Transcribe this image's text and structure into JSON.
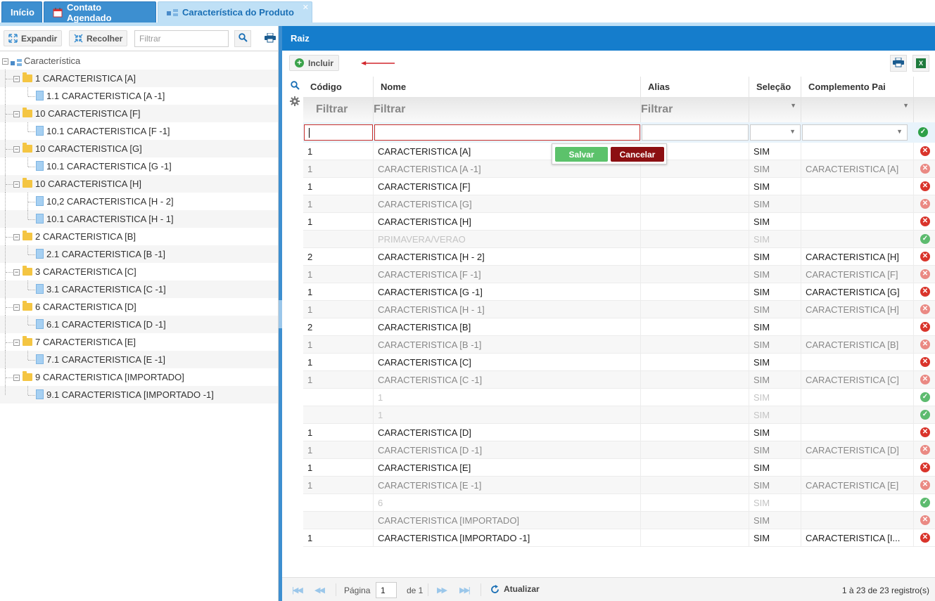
{
  "tabs": [
    {
      "label": "Início"
    },
    {
      "label": "Contato Agendado"
    },
    {
      "label": "Característica do Produto"
    }
  ],
  "left_panel": {
    "expand_label": "Expandir",
    "collapse_label": "Recolher",
    "filter_placeholder": "Filtrar",
    "tree_root": "Característica",
    "tree": [
      {
        "label": "1 CARACTERISTICA [A]",
        "level": 1,
        "type": "folder"
      },
      {
        "label": "1.1 CARACTERISTICA [A -1]",
        "level": 2,
        "type": "file"
      },
      {
        "label": "10 CARACTERISTICA [F]",
        "level": 1,
        "type": "folder"
      },
      {
        "label": "10.1 CARACTERISTICA [F -1]",
        "level": 2,
        "type": "file"
      },
      {
        "label": "10 CARACTERISTICA [G]",
        "level": 1,
        "type": "folder"
      },
      {
        "label": "10.1 CARACTERISTICA [G -1]",
        "level": 2,
        "type": "file"
      },
      {
        "label": "10 CARACTERISTICA [H]",
        "level": 1,
        "type": "folder"
      },
      {
        "label": "10,2 CARACTERISTICA [H - 2]",
        "level": 2,
        "type": "file"
      },
      {
        "label": "10.1 CARACTERISTICA [H - 1]",
        "level": 2,
        "type": "file"
      },
      {
        "label": "2 CARACTERISTICA [B]",
        "level": 1,
        "type": "folder"
      },
      {
        "label": "2.1 CARACTERISTICA [B -1]",
        "level": 2,
        "type": "file"
      },
      {
        "label": "3 CARACTERISTICA [C]",
        "level": 1,
        "type": "folder"
      },
      {
        "label": "3.1 CARACTERISTICA [C -1]",
        "level": 2,
        "type": "file"
      },
      {
        "label": "6 CARACTERISTICA [D]",
        "level": 1,
        "type": "folder"
      },
      {
        "label": "6.1 CARACTERISTICA [D -1]",
        "level": 2,
        "type": "file"
      },
      {
        "label": "7 CARACTERISTICA [E]",
        "level": 1,
        "type": "folder"
      },
      {
        "label": "7.1 CARACTERISTICA [E -1]",
        "level": 2,
        "type": "file"
      },
      {
        "label": "9 CARACTERISTICA [IMPORTADO]",
        "level": 1,
        "type": "folder"
      },
      {
        "label": "9.1 CARACTERISTICA [IMPORTADO -1]",
        "level": 2,
        "type": "file"
      }
    ]
  },
  "right_panel": {
    "title": "Raiz",
    "add_label": "Incluir",
    "columns": [
      "Código",
      "Nome",
      "Alias",
      "Seleção",
      "Complemento Pai"
    ],
    "filter_label": "Filtrar",
    "save_label": "Salvar",
    "cancel_label": "Cancelar",
    "rows": [
      {
        "codigo": "1",
        "nome": "CARACTERISTICA [A]",
        "alias": "",
        "selecao": "SIM",
        "complemento": "",
        "style": "normal",
        "action": "delete"
      },
      {
        "codigo": "1",
        "nome": "CARACTERISTICA [A -1]",
        "alias": "",
        "selecao": "SIM",
        "complemento": "CARACTERISTICA [A]",
        "style": "dim",
        "action": "delete"
      },
      {
        "codigo": "1",
        "nome": "CARACTERISTICA [F]",
        "alias": "",
        "selecao": "SIM",
        "complemento": "",
        "style": "normal",
        "action": "delete"
      },
      {
        "codigo": "1",
        "nome": "CARACTERISTICA [G]",
        "alias": "",
        "selecao": "SIM",
        "complemento": "",
        "style": "dim",
        "action": "delete"
      },
      {
        "codigo": "1",
        "nome": "CARACTERISTICA [H]",
        "alias": "",
        "selecao": "SIM",
        "complemento": "",
        "style": "normal",
        "action": "delete"
      },
      {
        "codigo": "",
        "nome": "PRIMAVERA/VERAO",
        "alias": "",
        "selecao": "SIM",
        "complemento": "",
        "style": "ghost",
        "action": "activate"
      },
      {
        "codigo": "2",
        "nome": "CARACTERISTICA [H - 2]",
        "alias": "",
        "selecao": "SIM",
        "complemento": "CARACTERISTICA [H]",
        "style": "normal",
        "action": "delete"
      },
      {
        "codigo": "1",
        "nome": "CARACTERISTICA [F -1]",
        "alias": "",
        "selecao": "SIM",
        "complemento": "CARACTERISTICA [F]",
        "style": "dim",
        "action": "delete"
      },
      {
        "codigo": "1",
        "nome": "CARACTERISTICA [G -1]",
        "alias": "",
        "selecao": "SIM",
        "complemento": "CARACTERISTICA [G]",
        "style": "normal",
        "action": "delete"
      },
      {
        "codigo": "1",
        "nome": "CARACTERISTICA [H - 1]",
        "alias": "",
        "selecao": "SIM",
        "complemento": "CARACTERISTICA [H]",
        "style": "dim",
        "action": "delete"
      },
      {
        "codigo": "2",
        "nome": "CARACTERISTICA [B]",
        "alias": "",
        "selecao": "SIM",
        "complemento": "",
        "style": "normal",
        "action": "delete"
      },
      {
        "codigo": "1",
        "nome": "CARACTERISTICA [B -1]",
        "alias": "",
        "selecao": "SIM",
        "complemento": "CARACTERISTICA [B]",
        "style": "dim",
        "action": "delete"
      },
      {
        "codigo": "1",
        "nome": "CARACTERISTICA [C]",
        "alias": "",
        "selecao": "SIM",
        "complemento": "",
        "style": "normal",
        "action": "delete"
      },
      {
        "codigo": "1",
        "nome": "CARACTERISTICA [C -1]",
        "alias": "",
        "selecao": "SIM",
        "complemento": "CARACTERISTICA [C]",
        "style": "dim",
        "action": "delete"
      },
      {
        "codigo": "",
        "nome": "1",
        "alias": "",
        "selecao": "SIM",
        "complemento": "",
        "style": "ghost",
        "action": "activate"
      },
      {
        "codigo": "",
        "nome": "1",
        "alias": "",
        "selecao": "SIM",
        "complemento": "",
        "style": "ghost",
        "action": "activate"
      },
      {
        "codigo": "1",
        "nome": "CARACTERISTICA [D]",
        "alias": "",
        "selecao": "SIM",
        "complemento": "",
        "style": "normal",
        "action": "delete"
      },
      {
        "codigo": "1",
        "nome": "CARACTERISTICA [D -1]",
        "alias": "",
        "selecao": "SIM",
        "complemento": "CARACTERISTICA [D]",
        "style": "dim",
        "action": "delete"
      },
      {
        "codigo": "1",
        "nome": "CARACTERISTICA [E]",
        "alias": "",
        "selecao": "SIM",
        "complemento": "",
        "style": "normal",
        "action": "delete"
      },
      {
        "codigo": "1",
        "nome": "CARACTERISTICA [E -1]",
        "alias": "",
        "selecao": "SIM",
        "complemento": "CARACTERISTICA [E]",
        "style": "dim",
        "action": "delete"
      },
      {
        "codigo": "",
        "nome": "6",
        "alias": "",
        "selecao": "SIM",
        "complemento": "",
        "style": "ghost",
        "action": "activate"
      },
      {
        "codigo": "",
        "nome": "CARACTERISTICA [IMPORTADO]",
        "alias": "",
        "selecao": "SIM",
        "complemento": "",
        "style": "dim",
        "action": "delete"
      },
      {
        "codigo": "1",
        "nome": "CARACTERISTICA [IMPORTADO -1]",
        "alias": "",
        "selecao": "SIM",
        "complemento": "CARACTERISTICA [I...",
        "style": "normal",
        "action": "delete"
      }
    ],
    "pager": {
      "page_label": "Página",
      "page_value": "1",
      "of_label": "de 1",
      "refresh_label": "Atualizar",
      "summary": "1 à 23 de 23 registro(s)"
    }
  },
  "colors": {
    "header_blue": "#157dcc",
    "tab_blue": "#3d8fd0",
    "save_green": "#5cc26b",
    "cancel_red": "#8c0f12"
  }
}
